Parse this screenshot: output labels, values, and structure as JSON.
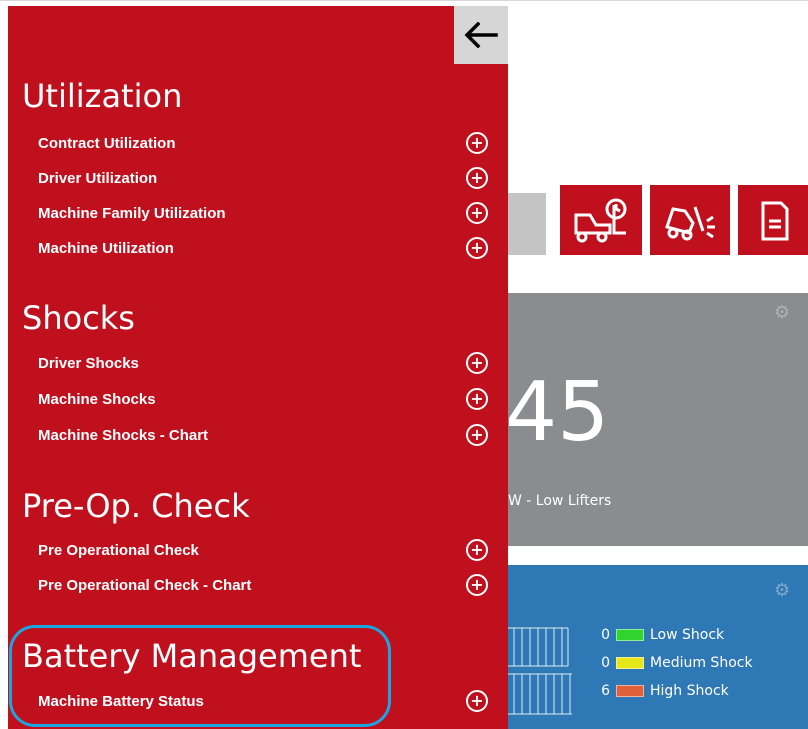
{
  "drawer": {
    "back_icon": "arrow-left-icon",
    "sections": [
      {
        "title": "Utilization",
        "items": [
          "Contract Utilization",
          "Driver Utilization",
          "Machine Family Utilization",
          "Machine Utilization"
        ]
      },
      {
        "title": "Shocks",
        "items": [
          "Driver Shocks",
          "Machine Shocks",
          "Machine Shocks - Chart"
        ]
      },
      {
        "title": "Pre-Op. Check",
        "items": [
          "Pre Operational Check",
          "Pre Operational Check - Chart"
        ]
      },
      {
        "title": "Battery Management",
        "items": [
          "Machine Battery Status"
        ]
      }
    ]
  },
  "background": {
    "tile_gray": {
      "value": "45",
      "caption": "W - Low Lifters"
    },
    "legend": [
      {
        "count": "0",
        "label": "Low Shock",
        "color": "#2fd42f"
      },
      {
        "count": "0",
        "label": "Medium Shock",
        "color": "#e6e61a"
      },
      {
        "count": "6",
        "label": "High Shock",
        "color": "#e0603a"
      }
    ]
  },
  "colors": {
    "drawer": "#c0101e",
    "tile_gray": "#8a8d8f",
    "tile_blue": "#2e79b5",
    "highlight": "#1aa6e0"
  }
}
